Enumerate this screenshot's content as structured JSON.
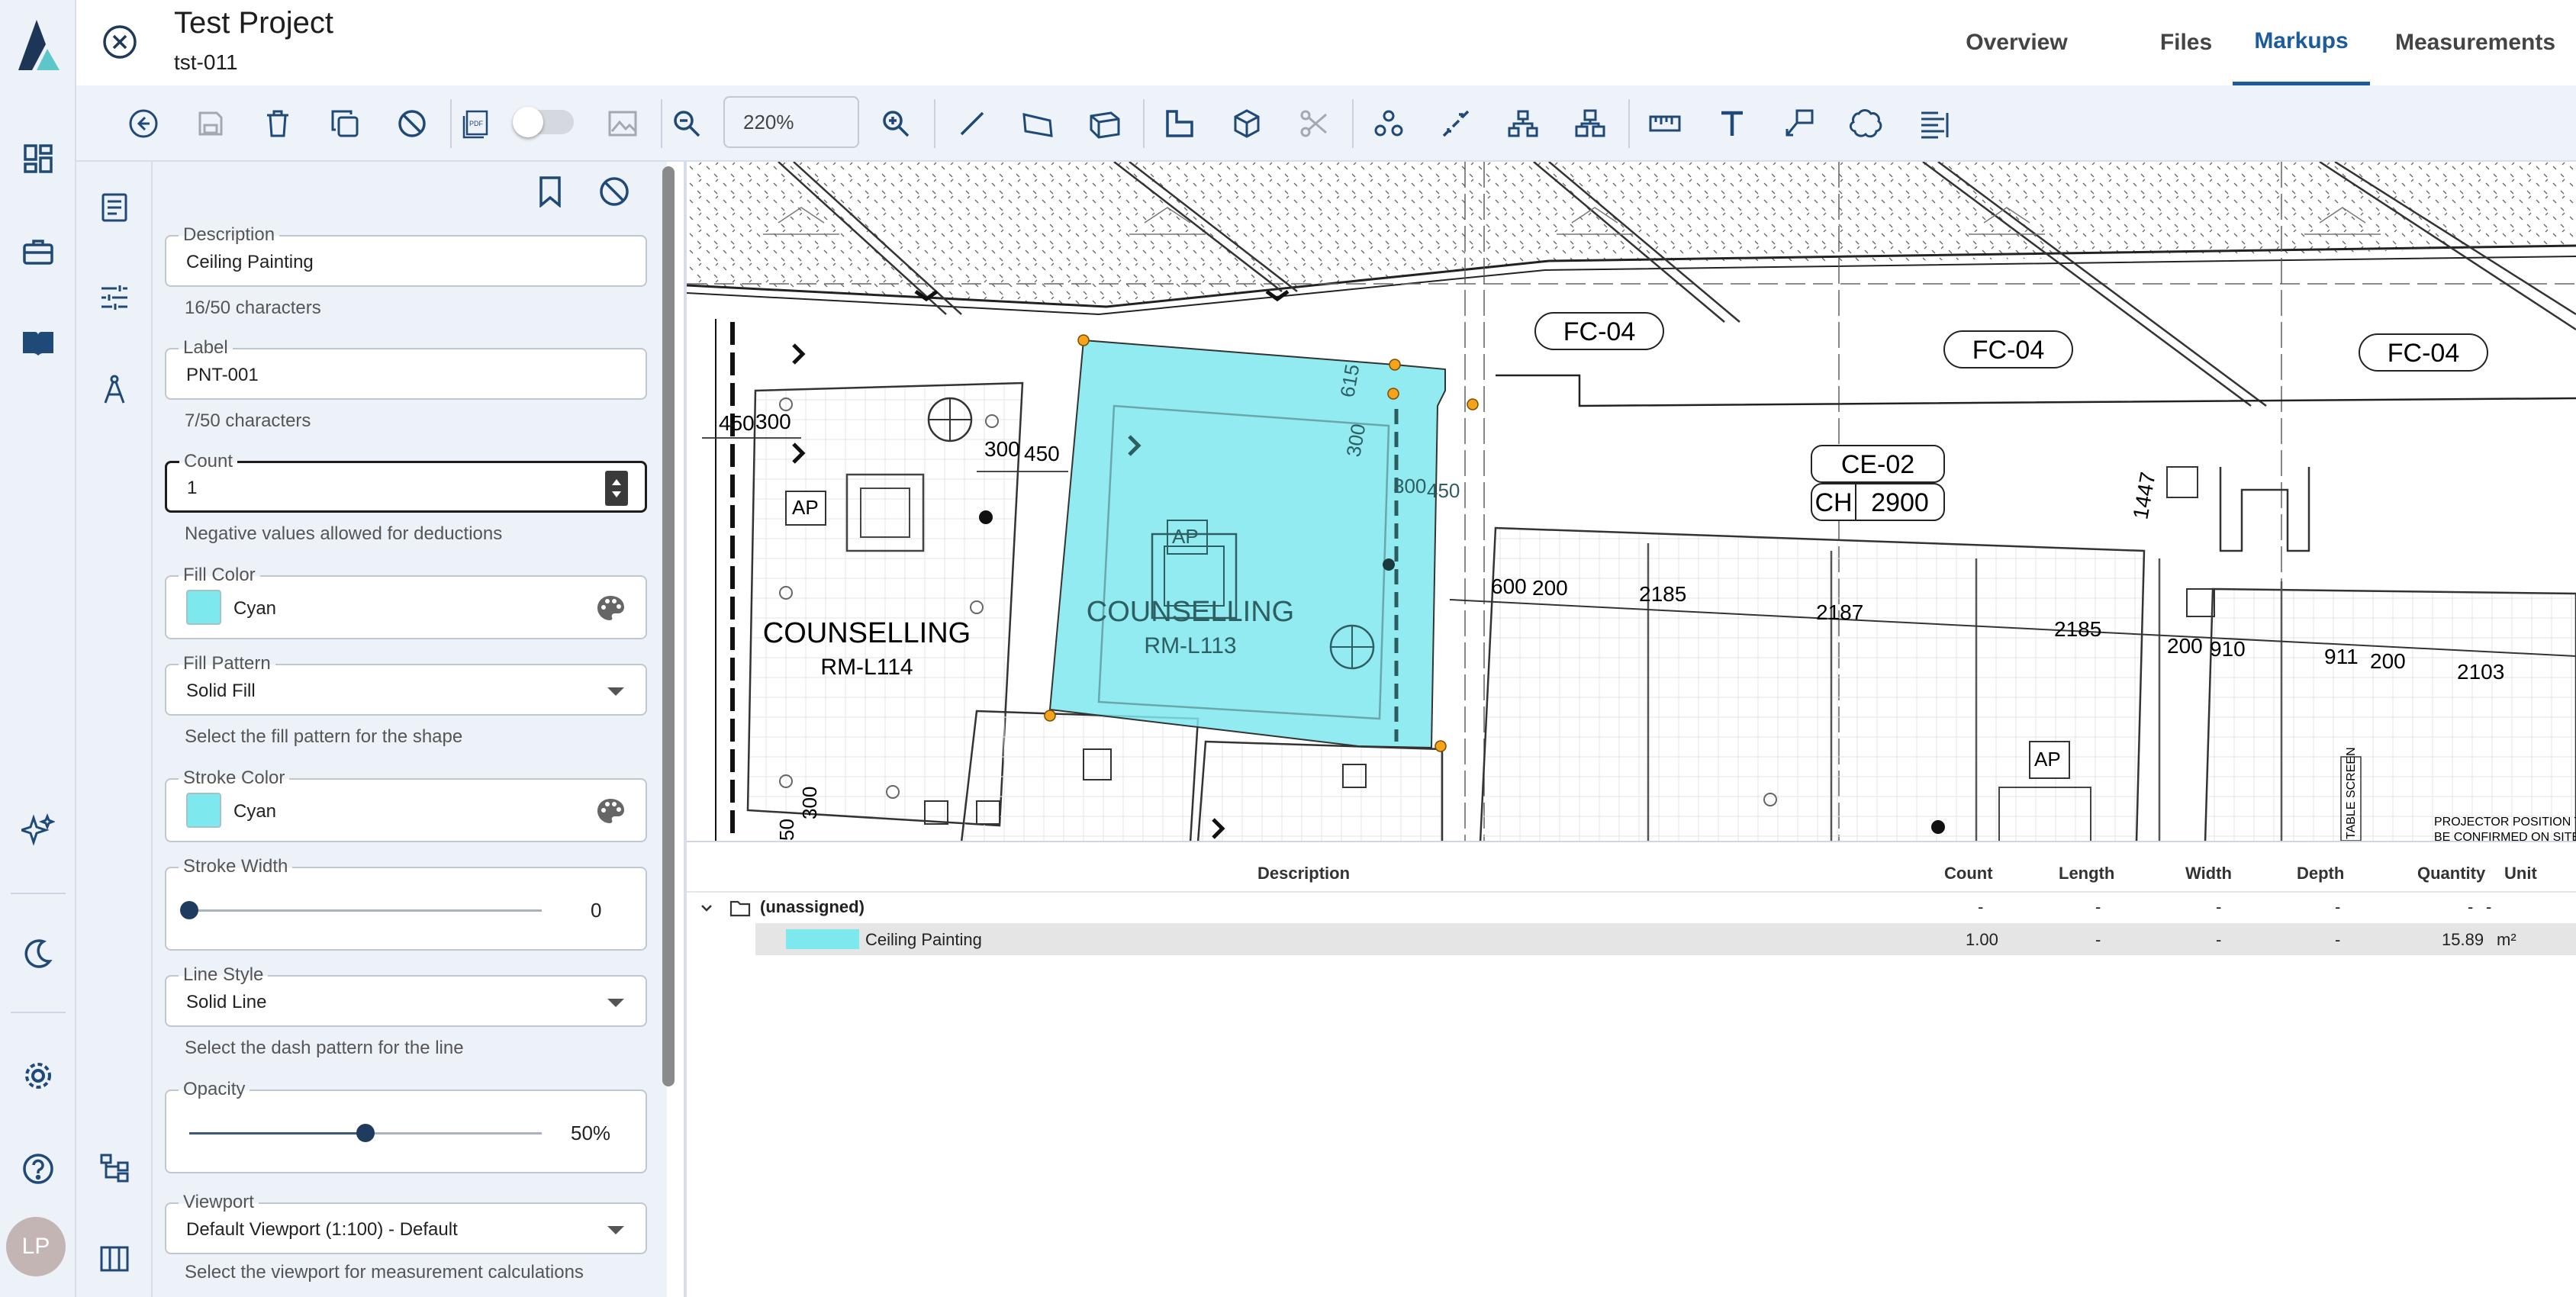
{
  "app": {
    "logo": "app-logo",
    "user_initials": "LP"
  },
  "header": {
    "title": "Test Project",
    "subtitle": "tst-011",
    "tabs": [
      {
        "label": "Overview",
        "active": false
      },
      {
        "label": "Files",
        "active": false
      },
      {
        "label": "Markups",
        "active": true
      },
      {
        "label": "Measurements",
        "active": false
      }
    ]
  },
  "toolbar": {
    "zoom": "220%"
  },
  "panel": {
    "description": {
      "label": "Description",
      "value": "Ceiling Painting",
      "helper": "16/50 characters"
    },
    "label_field": {
      "label": "Label",
      "value": "PNT-001",
      "helper": "7/50 characters"
    },
    "count": {
      "label": "Count",
      "value": "1",
      "helper": "Negative values allowed for deductions"
    },
    "fill_color": {
      "label": "Fill Color",
      "value": "Cyan",
      "color": "#7ee8ef"
    },
    "fill_pattern": {
      "label": "Fill Pattern",
      "value": "Solid Fill",
      "helper": "Select the fill pattern for the shape"
    },
    "stroke_color": {
      "label": "Stroke Color",
      "value": "Cyan",
      "color": "#7ee8ef"
    },
    "stroke_width": {
      "label": "Stroke Width",
      "value": "0"
    },
    "line_style": {
      "label": "Line Style",
      "value": "Solid Line",
      "helper": "Select the dash pattern for the line"
    },
    "opacity": {
      "label": "Opacity",
      "value": "50%",
      "fraction": 0.5
    },
    "viewport": {
      "label": "Viewport",
      "value": "Default Viewport (1:100) - Default",
      "helper": "Select the viewport for measurement calculations"
    }
  },
  "plan": {
    "room_a_name": "COUNSELLING",
    "room_a_id": "RM-L114",
    "room_b_name": "COUNSELLING",
    "room_b_id": "RM-L113",
    "fc_tags": [
      "FC-04",
      "FC-04",
      "FC-04"
    ],
    "ce_tag": "CE-02",
    "ch_label": "CH",
    "ch_value": "2900",
    "dims": [
      "450",
      "300",
      "300",
      "450",
      "615",
      "300",
      "300",
      "450",
      "600",
      "200",
      "2185",
      "2187",
      "2185",
      "200",
      "910",
      "911",
      "200",
      "2103",
      "1447",
      "50",
      "300"
    ],
    "ap": "AP",
    "note_line1": "PROJECTOR POSITION TO",
    "note_line2": "BE CONFIRMED ON SITE",
    "table_screen": "TABLE SCREEN"
  },
  "table": {
    "columns": [
      "Description",
      "Count",
      "Length",
      "Width",
      "Depth",
      "Quantity",
      "Unit"
    ],
    "group": {
      "name": "(unassigned)",
      "count": "-",
      "length": "-",
      "width": "-",
      "depth": "-",
      "quantity": "-",
      "unit": "-"
    },
    "rows": [
      {
        "description": "Ceiling Painting",
        "color": "#7ee8ef",
        "count": "1.00",
        "length": "-",
        "width": "-",
        "depth": "-",
        "quantity": "15.89",
        "unit": "m²"
      }
    ]
  }
}
